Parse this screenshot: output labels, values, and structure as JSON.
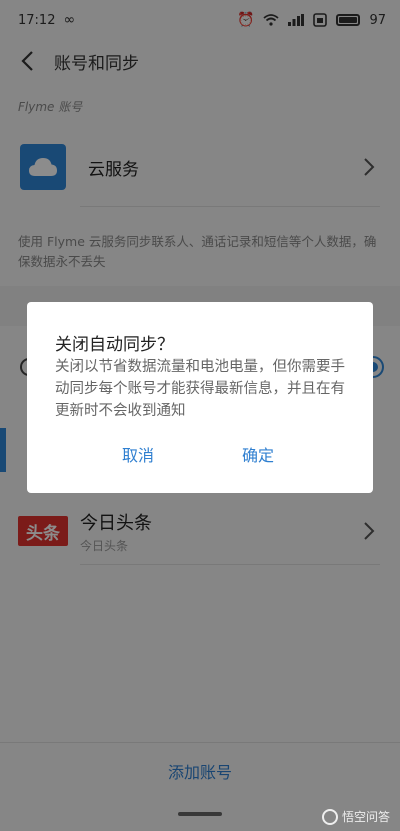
{
  "status_bar": {
    "time": "17:12",
    "battery": "97"
  },
  "header": {
    "title": "账号和同步"
  },
  "section": {
    "label": "Flyme 账号"
  },
  "cloud": {
    "label": "云服务"
  },
  "description": "使用 Flyme 云服务同步联系人、通话记录和短信等个人数据，确保数据永不丢失",
  "toutiao": {
    "logo": "头条",
    "name": "今日头条",
    "sub": "今日头条"
  },
  "bottom": {
    "add_account": "添加账号"
  },
  "dialog": {
    "title": "关闭自动同步？",
    "message": "关闭以节省数据流量和电池电量，但你需要手动同步每个账号才能获得最新信息，并且在有更新时不会收到通知",
    "cancel": "取消",
    "confirm": "确定"
  },
  "watermark": "悟空问答",
  "colors": {
    "accent": "#2f7fd0",
    "toutiao_red": "#e0322e",
    "cloud_blue": "#2f86d6"
  }
}
